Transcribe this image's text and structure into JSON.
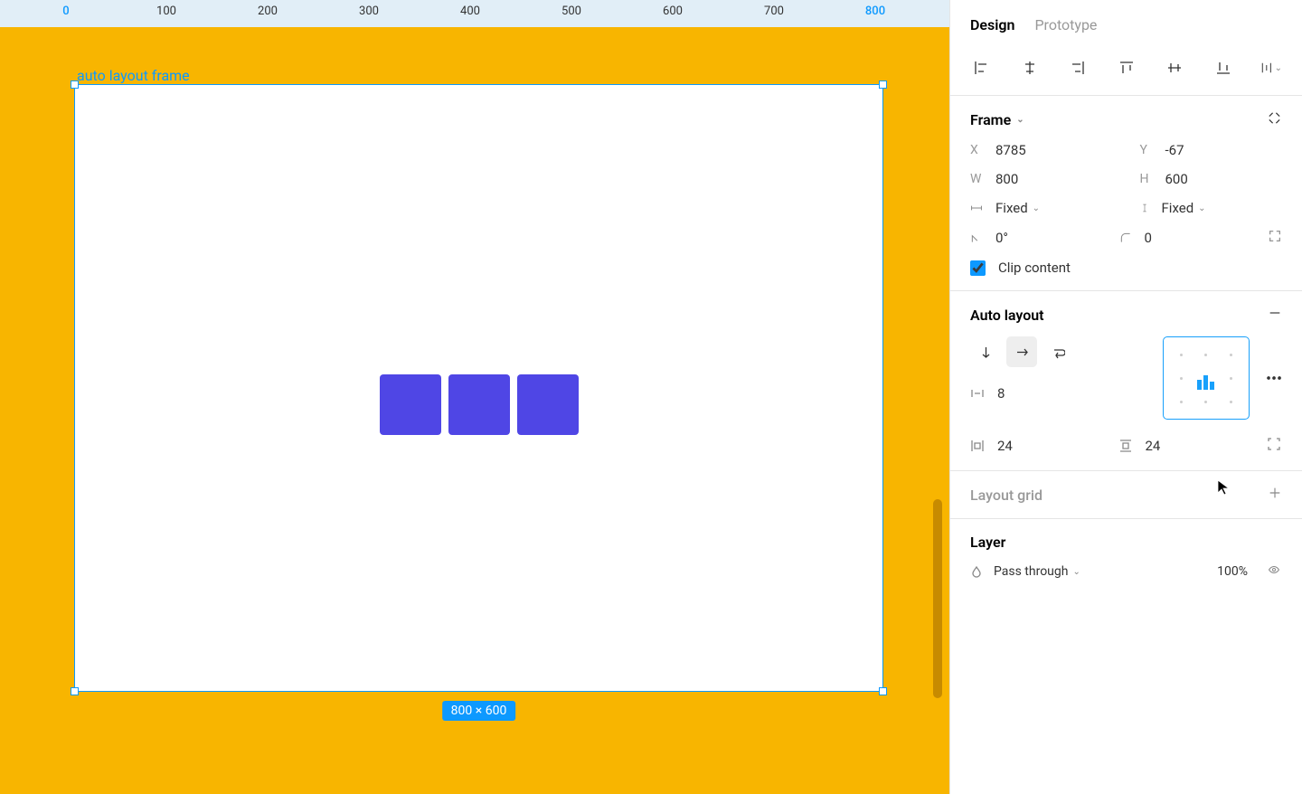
{
  "ruler": {
    "ticks": [
      "0",
      "100",
      "200",
      "300",
      "400",
      "500",
      "600",
      "700",
      "800"
    ]
  },
  "frame_label": "auto layout frame",
  "dim_badge": "800 × 600",
  "tabs": {
    "design": "Design",
    "prototype": "Prototype"
  },
  "frame": {
    "title": "Frame",
    "x_label": "X",
    "x_val": "8785",
    "y_label": "Y",
    "y_val": "-67",
    "w_label": "W",
    "w_val": "800",
    "h_label": "H",
    "h_val": "600",
    "hresize": "Fixed",
    "vresize": "Fixed",
    "rotation": "0°",
    "radius": "0",
    "clip": "Clip content"
  },
  "autolayout": {
    "title": "Auto layout",
    "gap": "8",
    "pad_h": "24",
    "pad_v": "24"
  },
  "layout_grid": {
    "title": "Layout grid"
  },
  "layer": {
    "title": "Layer",
    "blend": "Pass through",
    "opacity": "100%"
  }
}
